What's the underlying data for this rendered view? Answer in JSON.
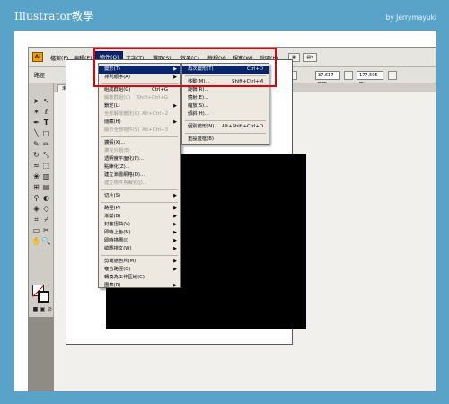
{
  "banner": {
    "title": "Illustrator教學",
    "author": "by Jerrymayuki"
  },
  "app": {
    "logo": "Ai",
    "menubar": [
      {
        "label": "檔案(F)",
        "active": false
      },
      {
        "label": "編輯(E)",
        "active": false
      },
      {
        "label": "物件(O)",
        "active": true
      },
      {
        "label": "文字(T)",
        "active": false
      },
      {
        "label": "選取(S)",
        "active": false
      },
      {
        "label": "效果(C)",
        "active": false
      },
      {
        "label": "檢視(V)",
        "active": false
      },
      {
        "label": "視窗(W)",
        "active": false
      },
      {
        "label": "說明(H)",
        "active": false
      }
    ],
    "control_bar": {
      "label": "路徑",
      "field_x": "37.617 mm",
      "field_w": "177.595 m"
    },
    "document_tab": "未命名-2* @ 85"
  },
  "object_menu": {
    "items": [
      {
        "label": "變形(T)",
        "shortcut": "",
        "submenu": true,
        "disabled": false,
        "highlight": true
      },
      {
        "label": "排列順序(A)",
        "shortcut": "",
        "submenu": true,
        "disabled": false,
        "highlight": false
      },
      {
        "sep": true
      },
      {
        "label": "組成群組(G)",
        "shortcut": "Ctrl+G",
        "submenu": false,
        "disabled": false,
        "highlight": false
      },
      {
        "label": "解散群組(U)",
        "shortcut": "Shift+Ctrl+G",
        "submenu": false,
        "disabled": true,
        "highlight": false
      },
      {
        "label": "鎖定(L)",
        "shortcut": "",
        "submenu": true,
        "disabled": false,
        "highlight": false
      },
      {
        "label": "全部解除鎖定(K)",
        "shortcut": "Alt+Ctrl+2",
        "submenu": false,
        "disabled": true,
        "highlight": false
      },
      {
        "label": "隱藏(H)",
        "shortcut": "",
        "submenu": true,
        "disabled": false,
        "highlight": false
      },
      {
        "label": "顯示全部物件(S)",
        "shortcut": "Alt+Ctrl+3",
        "submenu": false,
        "disabled": true,
        "highlight": false
      },
      {
        "sep": true
      },
      {
        "label": "擴張(X)...",
        "shortcut": "",
        "submenu": false,
        "disabled": false,
        "highlight": false
      },
      {
        "label": "擴充外觀(E)",
        "shortcut": "",
        "submenu": false,
        "disabled": true,
        "highlight": false
      },
      {
        "label": "透明度平面化(F)...",
        "shortcut": "",
        "submenu": false,
        "disabled": false,
        "highlight": false
      },
      {
        "label": "點陣化(Z)...",
        "shortcut": "",
        "submenu": false,
        "disabled": false,
        "highlight": false
      },
      {
        "label": "建立漸層網格(D)...",
        "shortcut": "",
        "submenu": false,
        "disabled": false,
        "highlight": false
      },
      {
        "label": "建立物件馬賽克(J)...",
        "shortcut": "",
        "submenu": false,
        "disabled": true,
        "highlight": false
      },
      {
        "sep": true
      },
      {
        "label": "切片(S)",
        "shortcut": "",
        "submenu": true,
        "disabled": false,
        "highlight": false
      },
      {
        "sep": true
      },
      {
        "label": "路徑(P)",
        "shortcut": "",
        "submenu": true,
        "disabled": false,
        "highlight": false
      },
      {
        "label": "漸變(B)",
        "shortcut": "",
        "submenu": true,
        "disabled": false,
        "highlight": false
      },
      {
        "label": "封套扭曲(V)",
        "shortcut": "",
        "submenu": true,
        "disabled": false,
        "highlight": false
      },
      {
        "label": "即時上色(N)",
        "shortcut": "",
        "submenu": true,
        "disabled": false,
        "highlight": false
      },
      {
        "label": "即時描圖(I)",
        "shortcut": "",
        "submenu": true,
        "disabled": false,
        "highlight": false
      },
      {
        "label": "繞圖排文(W)",
        "shortcut": "",
        "submenu": true,
        "disabled": false,
        "highlight": false
      },
      {
        "sep": true
      },
      {
        "label": "剪裁遮色片(M)",
        "shortcut": "",
        "submenu": true,
        "disabled": false,
        "highlight": false
      },
      {
        "label": "複合路徑(O)",
        "shortcut": "",
        "submenu": true,
        "disabled": false,
        "highlight": false
      },
      {
        "label": "轉換為工作區域(C)",
        "shortcut": "",
        "submenu": false,
        "disabled": false,
        "highlight": false
      },
      {
        "label": "圖表(R)",
        "shortcut": "",
        "submenu": true,
        "disabled": false,
        "highlight": false
      }
    ]
  },
  "transform_submenu": {
    "items": [
      {
        "label": "再次變形(T)",
        "shortcut": "Ctrl+D",
        "highlight": true
      },
      {
        "sep": true
      },
      {
        "label": "移動(M)...",
        "shortcut": "Shift+Ctrl+M",
        "highlight": false
      },
      {
        "label": "旋轉(R)...",
        "shortcut": "",
        "highlight": false
      },
      {
        "label": "鏡射(E)...",
        "shortcut": "",
        "highlight": false
      },
      {
        "label": "縮放(S)...",
        "shortcut": "",
        "highlight": false
      },
      {
        "label": "傾斜(H)...",
        "shortcut": "",
        "highlight": false
      },
      {
        "sep": true
      },
      {
        "label": "個別變形(N)...",
        "shortcut": "Alt+Shift+Ctrl+D",
        "highlight": false
      },
      {
        "sep": true
      },
      {
        "label": "重設邊框(B)",
        "shortcut": "",
        "highlight": false
      }
    ]
  }
}
